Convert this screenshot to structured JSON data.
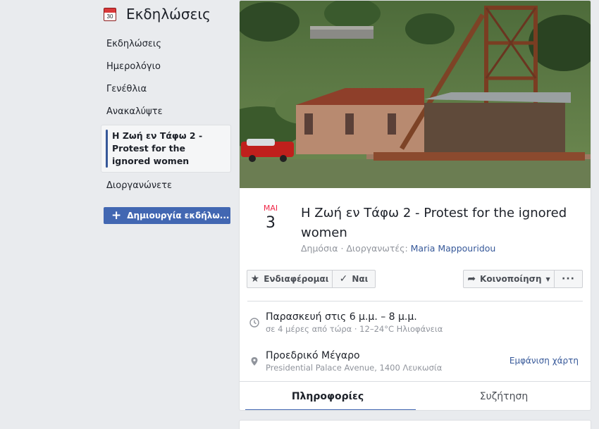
{
  "sidebar": {
    "title": "Εκδηλώσεις",
    "calendar_icon_day": "30",
    "items": [
      {
        "label": "Εκδηλώσεις"
      },
      {
        "label": "Ημερολόγιο"
      },
      {
        "label": "Γενέθλια"
      },
      {
        "label": "Ανακαλύψτε"
      }
    ],
    "active_event": "Η Ζωή εν Τάφω 2 - Protest for the ignored women",
    "after_item": "Διοργανώνετε",
    "create_button": "Δημιουργία εκδήλω..."
  },
  "event": {
    "month": "ΜΑΙ",
    "day": "3",
    "title": "Η Ζωή εν Τάφω 2 - Protest for the ignored women",
    "meta_prefix": "Δημόσια · Διοργανωτές: ",
    "organizer": "Maria Mappouridou",
    "actions": {
      "interested": "Ενδιαφέρομαι",
      "going": "Ναι",
      "share": "Κοινοποίηση",
      "more": "···"
    },
    "time": {
      "main": "Παρασκευή στις 6 μ.μ. – 8 μ.μ.",
      "sub": "σε 4 μέρες από τώρα · 12–24°C Ηλιοφάνεια"
    },
    "location": {
      "name": "Προεδρικό Μέγαρο",
      "address": "Presidential Palace Avenue, 1400 Λευκωσία",
      "map_link": "Εμφάνιση χάρτη"
    },
    "tabs": [
      {
        "label": "Πληροφορίες"
      },
      {
        "label": "Συζήτηση"
      }
    ]
  },
  "colors": {
    "accent": "#4267b2",
    "link": "#365899",
    "date_month": "#f02849"
  }
}
